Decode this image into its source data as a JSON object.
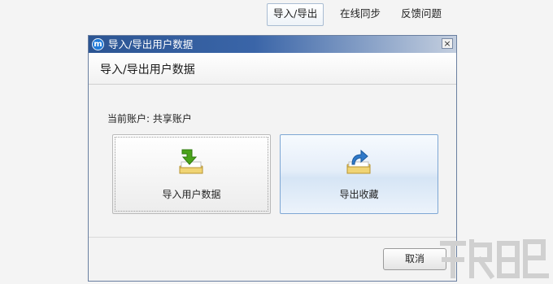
{
  "top_tabs": [
    {
      "label": "导入/导出",
      "active": true
    },
    {
      "label": "在线同步",
      "active": false
    },
    {
      "label": "反馈问题",
      "active": false
    }
  ],
  "dialog": {
    "title": "导入/导出用户数据",
    "app_icon": "m-logo-icon",
    "close_glyph": "×",
    "header_title": "导入/导出用户数据",
    "account_line": "当前账户: 共享账户",
    "import_card": {
      "label": "导入用户数据",
      "icon": "import-folder-icon"
    },
    "export_card": {
      "label": "导出收藏",
      "icon": "export-folder-icon"
    },
    "cancel_label": "取消"
  },
  "colors": {
    "titlebar_start": "#2c5593",
    "import_arrow": "#4aa31a",
    "export_arrow": "#2f79c9",
    "folder": "#e9c95c"
  }
}
